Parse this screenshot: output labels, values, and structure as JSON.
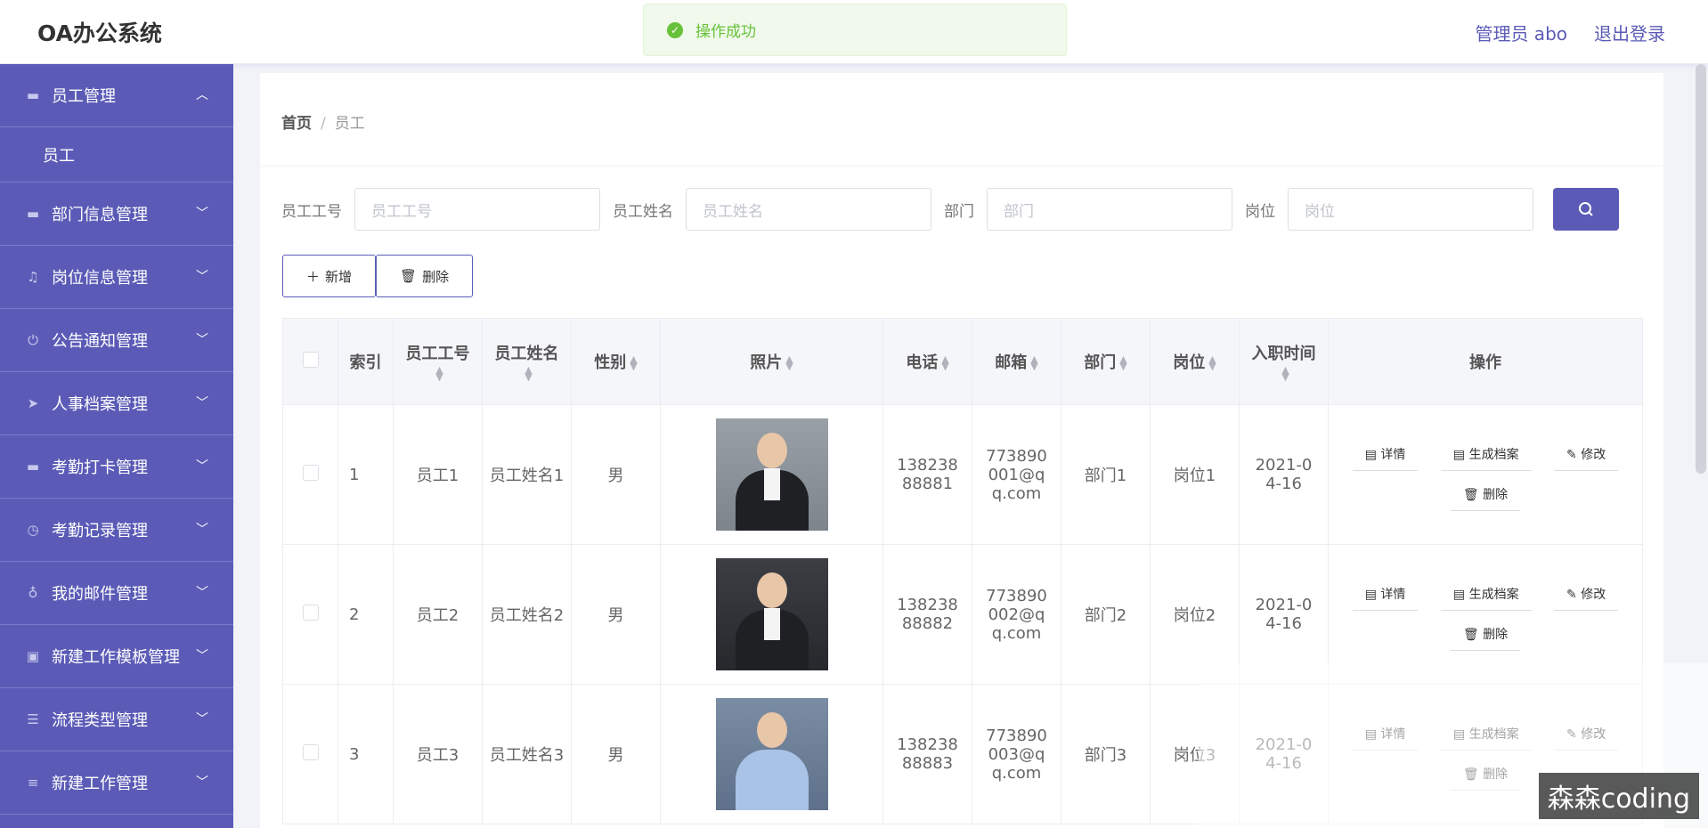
{
  "header": {
    "logo": "OA办公系统",
    "user": "管理员 abo",
    "logout": "退出登录"
  },
  "toast": {
    "message": "操作成功"
  },
  "sidebar": {
    "items": [
      {
        "label": "员工管理",
        "icon": "monitor-icon",
        "expanded": true
      },
      {
        "label": "部门信息管理",
        "icon": "monitor-icon"
      },
      {
        "label": "岗位信息管理",
        "icon": "bell-icon"
      },
      {
        "label": "公告通知管理",
        "icon": "power-icon"
      },
      {
        "label": "人事档案管理",
        "icon": "send-icon"
      },
      {
        "label": "考勤打卡管理",
        "icon": "monitor-icon"
      },
      {
        "label": "考勤记录管理",
        "icon": "clock-icon"
      },
      {
        "label": "我的邮件管理",
        "icon": "mic-icon"
      },
      {
        "label": "新建工作模板管理",
        "icon": "delete-file-icon"
      },
      {
        "label": "流程类型管理",
        "icon": "menu-icon"
      },
      {
        "label": "新建工作管理",
        "icon": "sliders-icon"
      }
    ],
    "sub_item": "员工"
  },
  "breadcrumb": {
    "home": "首页",
    "current": "员工"
  },
  "search": {
    "fields": [
      {
        "label": "员工工号",
        "placeholder": "员工工号"
      },
      {
        "label": "员工姓名",
        "placeholder": "员工姓名"
      },
      {
        "label": "部门",
        "placeholder": "部门"
      },
      {
        "label": "岗位",
        "placeholder": "岗位"
      }
    ]
  },
  "toolbar": {
    "add": "新增",
    "delete": "删除"
  },
  "table": {
    "headers": [
      "索引",
      "员工工号",
      "员工姓名",
      "性别",
      "照片",
      "电话",
      "邮箱",
      "部门",
      "岗位",
      "入职时间",
      "操作"
    ],
    "rows": [
      {
        "index": "1",
        "no": "员工1",
        "name": "员工姓名1",
        "sex": "男",
        "phone": "13823888881",
        "email": "773890001@qq.com",
        "dept": "部门1",
        "post": "岗位1",
        "date": "2021-04-16"
      },
      {
        "index": "2",
        "no": "员工2",
        "name": "员工姓名2",
        "sex": "男",
        "phone": "13823888882",
        "email": "773890002@qq.com",
        "dept": "部门2",
        "post": "岗位2",
        "date": "2021-04-16"
      },
      {
        "index": "3",
        "no": "员工3",
        "name": "员工姓名3",
        "sex": "男",
        "phone": "13823888883",
        "email": "773890003@qq.com",
        "dept": "部门3",
        "post": "岗位3",
        "date": "2021-04-16"
      }
    ],
    "actions": {
      "detail": "详情",
      "archive": "生成档案",
      "edit": "修改",
      "delete": "删除"
    }
  },
  "watermark": "森森coding"
}
